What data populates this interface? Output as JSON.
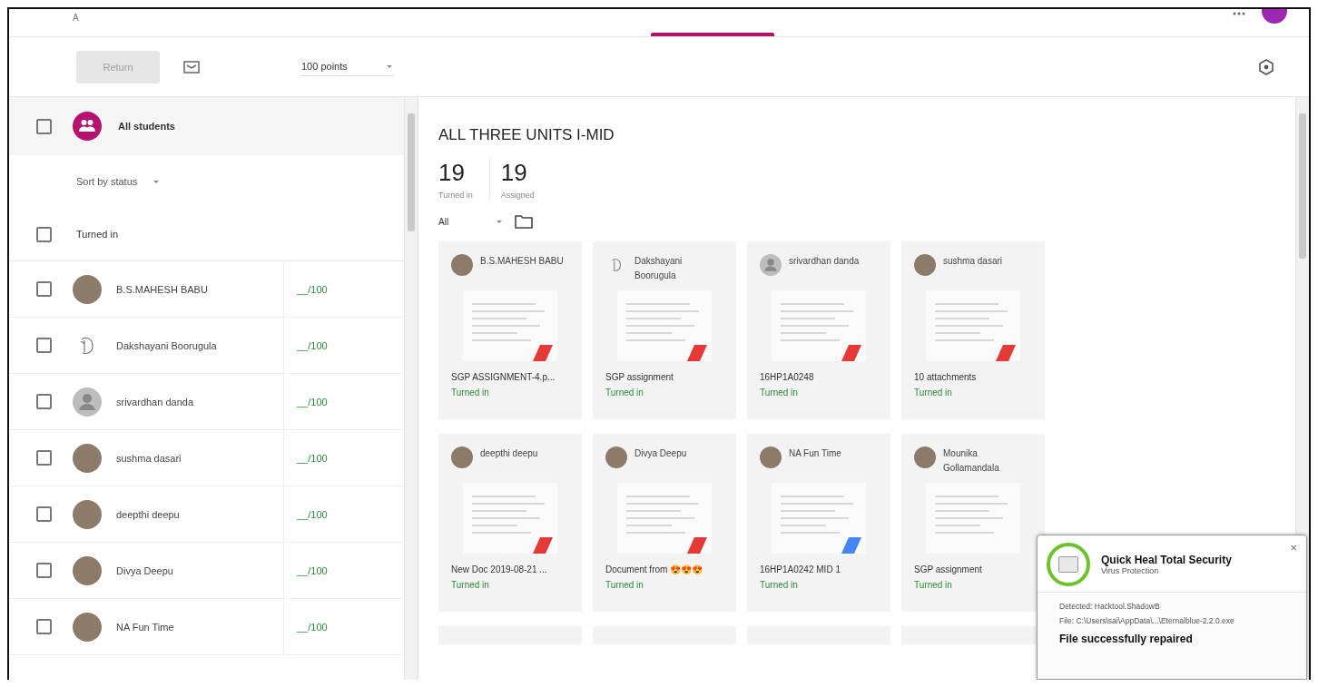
{
  "header": {
    "title_fragment": "A"
  },
  "toolbar": {
    "return_button": "Return",
    "points": "100 points"
  },
  "students_panel": {
    "all_students": {
      "label": "All students",
      "checked": false
    },
    "sort": "Sort by status",
    "group": {
      "label": "Turned in",
      "checked": false
    },
    "rows": [
      {
        "name": "B.S.MAHESH BABU",
        "grade": "__/100",
        "checked": false,
        "kind": "photo"
      },
      {
        "name": "Dakshayani Boorugula",
        "grade": "__/100",
        "checked": false,
        "kind": "glyph"
      },
      {
        "name": "srivardhan danda",
        "grade": "__/100",
        "checked": false,
        "kind": "generic"
      },
      {
        "name": "sushma dasari",
        "grade": "__/100",
        "checked": false,
        "kind": "photo"
      },
      {
        "name": "deepthi deepu",
        "grade": "__/100",
        "checked": false,
        "kind": "photo"
      },
      {
        "name": "Divya Deepu",
        "grade": "__/100",
        "checked": false,
        "kind": "photo"
      },
      {
        "name": "NA Fun Time",
        "grade": "__/100",
        "checked": false,
        "kind": "photo"
      }
    ]
  },
  "assignment": {
    "title": "ALL THREE UNITS I-MID",
    "stats": [
      {
        "value": "19",
        "label": "Turned in"
      },
      {
        "value": "19",
        "label": "Assigned"
      }
    ],
    "filter": "All",
    "cards": [
      {
        "name": "B.S.MAHESH BABU",
        "kind": "photo",
        "file": "SGP ASSIGNMENT-4.p...",
        "status": "Turned in",
        "color": "#e53935"
      },
      {
        "name": "Dakshayani Boorugula",
        "kind": "glyph",
        "file": "SGP assignment",
        "status": "Turned in",
        "color": "#e53935"
      },
      {
        "name": "srivardhan danda",
        "kind": "generic",
        "file": "16HP1A0248",
        "status": "Turned in",
        "color": "#e53935"
      },
      {
        "name": "sushma dasari",
        "kind": "photo",
        "file": "10 attachments",
        "status": "Turned in",
        "color": "#e53935"
      },
      {
        "name": "deepthi deepu",
        "kind": "photo",
        "file": "New Doc 2019-08-21 ...",
        "status": "Turned in",
        "color": "#e53935"
      },
      {
        "name": "Divya Deepu",
        "kind": "photo",
        "file": "Document from 😍😍😍",
        "status": "Turned in",
        "color": "#e53935"
      },
      {
        "name": "NA Fun Time",
        "kind": "photo",
        "file": "16HP1A0242 MID 1",
        "status": "Turned in",
        "color": "#4285f4"
      },
      {
        "name": "Mounika Gollamandala",
        "kind": "photo",
        "file": "SGP assignment",
        "status": "Turned in"
      }
    ]
  },
  "notification": {
    "app": "Quick Heal Total Security",
    "subtitle": "Virus Protection",
    "close": "×",
    "detected": "Detected: Hacktool.ShadowB",
    "file": "File: C:\\Users\\sai\\AppData\\...\\Eternalblue-2.2.0.exe",
    "result": "File successfully repaired"
  }
}
